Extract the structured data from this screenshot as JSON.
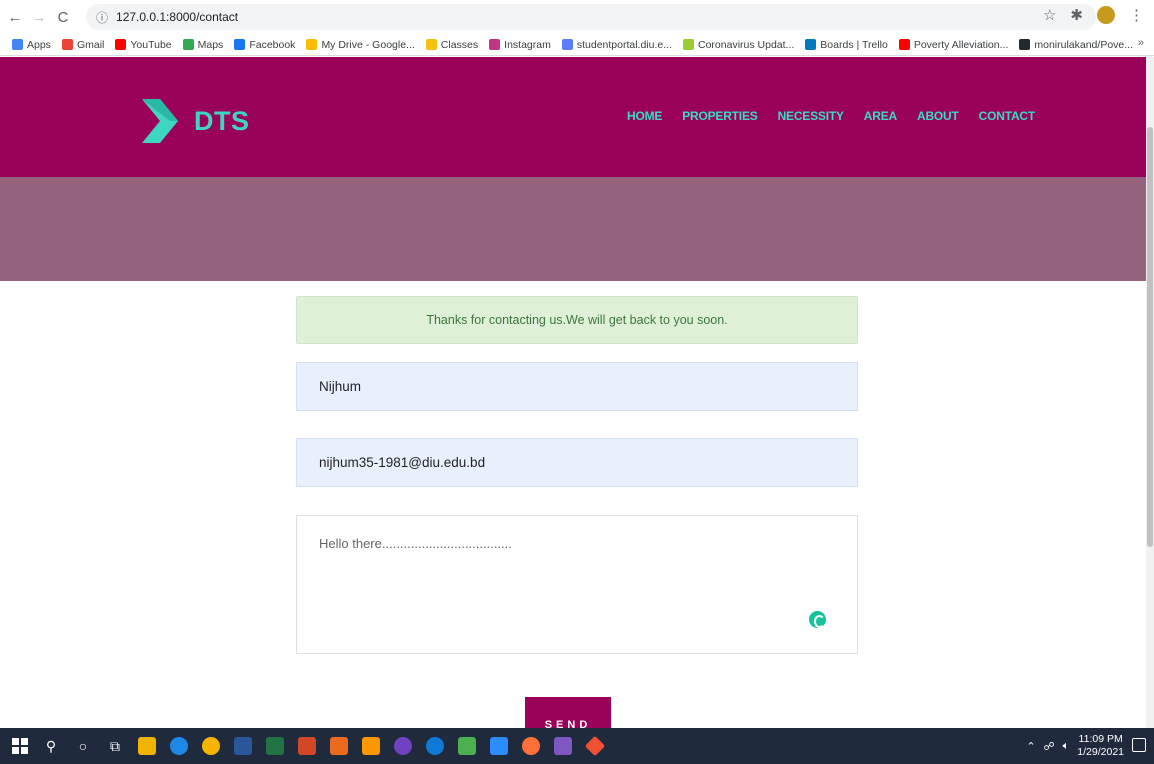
{
  "browser": {
    "url": "127.0.0.1:8000/contact",
    "bookmarks": [
      {
        "label": "Apps",
        "color": "#4285f4"
      },
      {
        "label": "Gmail",
        "color": "#ea4335"
      },
      {
        "label": "YouTube",
        "color": "#ff0000"
      },
      {
        "label": "Maps",
        "color": "#34a853"
      },
      {
        "label": "Facebook",
        "color": "#1877f2"
      },
      {
        "label": "My Drive - Google...",
        "color": "#fbbc05"
      },
      {
        "label": "Classes",
        "color": "#f4c20d"
      },
      {
        "label": "Instagram",
        "color": "#c13584"
      },
      {
        "label": "studentportal.diu.e...",
        "color": "#5c7cfa"
      },
      {
        "label": "Coronavirus Updat...",
        "color": "#9acd32"
      },
      {
        "label": "Boards | Trello",
        "color": "#0079bf"
      },
      {
        "label": "Poverty Alleviation...",
        "color": "#ff0000"
      },
      {
        "label": "monirulakand/Pove...",
        "color": "#24292e"
      }
    ],
    "more": "»"
  },
  "site": {
    "logo_text": "DTS",
    "brand_color": "#9a0158",
    "accent_color": "#37dcc5",
    "nav": [
      "HOME",
      "PROPERTIES",
      "NECESSITY",
      "AREA",
      "ABOUT",
      "CONTACT"
    ]
  },
  "contact": {
    "success_message": "Thanks for contacting us.We will get back to you soon.",
    "name_value": "Nijhum",
    "email_value": "nijhum35-1981@diu.edu.bd",
    "message_value": "Hello there....................................",
    "send_label": "SEND"
  },
  "taskbar": {
    "time": "11:09 PM",
    "date": "1/29/2021"
  }
}
